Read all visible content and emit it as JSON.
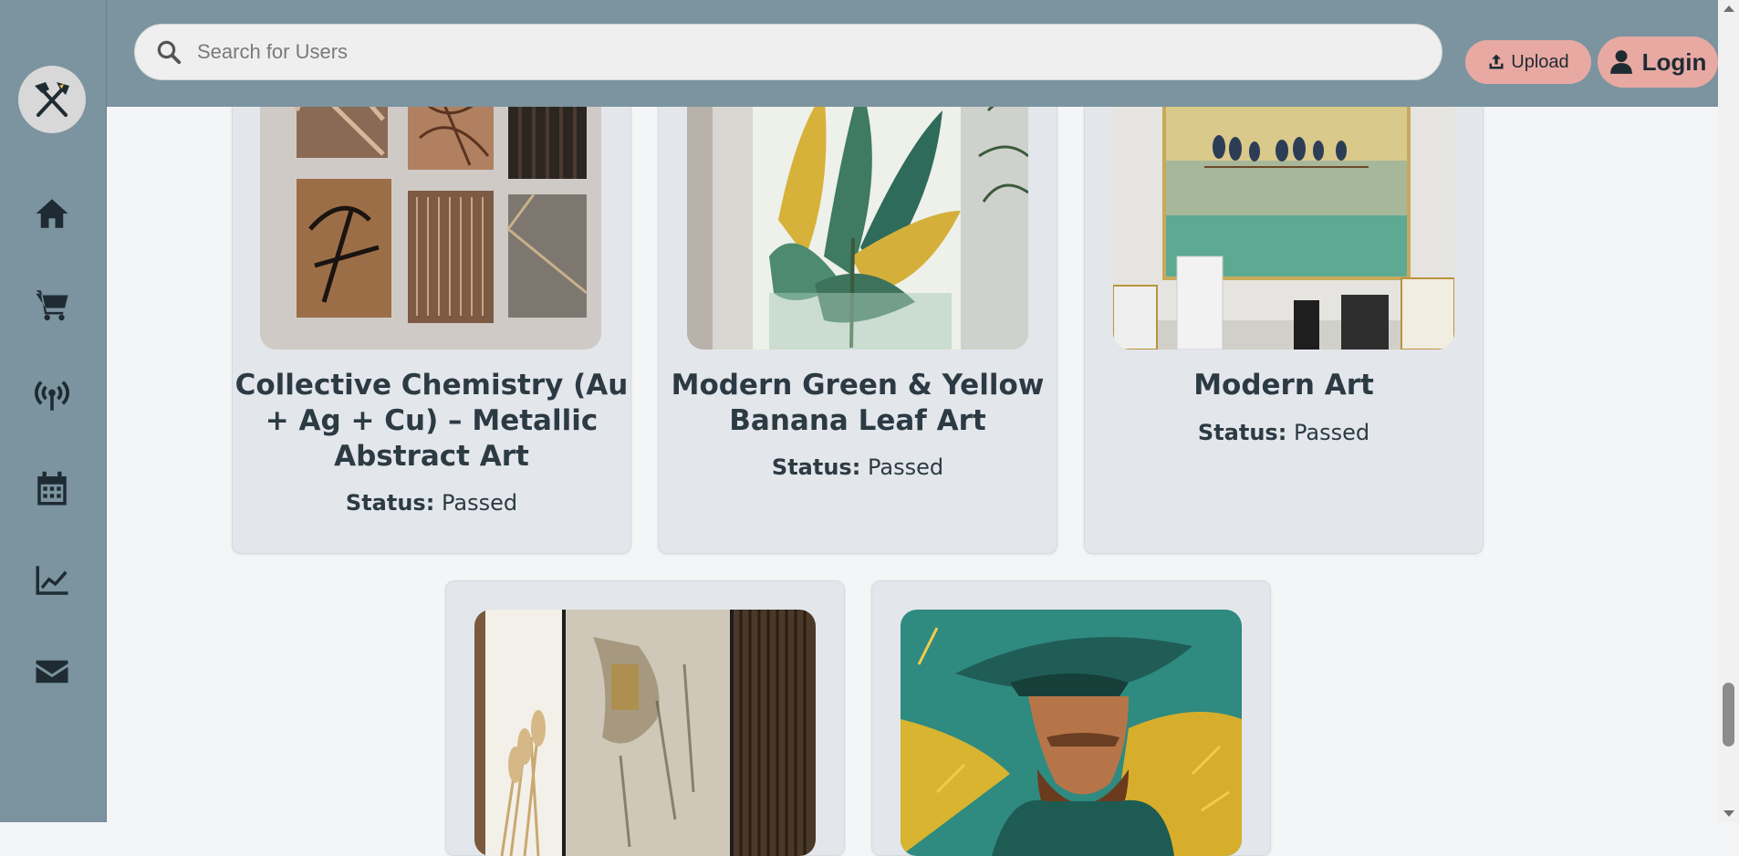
{
  "header": {
    "search_placeholder": "Search for Users",
    "upload_label": "Upload",
    "login_label": "Login"
  },
  "sidebar": {
    "items": [
      {
        "icon": "home-icon"
      },
      {
        "icon": "cart-icon"
      },
      {
        "icon": "broadcast-icon"
      },
      {
        "icon": "calendar-icon"
      },
      {
        "icon": "chart-line-icon"
      },
      {
        "icon": "envelope-icon"
      }
    ]
  },
  "cards": [
    {
      "title": "Collective Chemistry (Au + Ag + Cu) – Metallic Abstract Art",
      "status_label": "Status:",
      "status_value": "Passed"
    },
    {
      "title": "Modern Green & Yellow Banana Leaf Art",
      "status_label": "Status:",
      "status_value": "Passed"
    },
    {
      "title": "Modern Art",
      "status_label": "Status:",
      "status_value": "Passed"
    },
    {
      "title": "",
      "status_label": "",
      "status_value": ""
    },
    {
      "title": "",
      "status_label": "",
      "status_value": ""
    }
  ],
  "colors": {
    "sidebar": "#7b949f",
    "accent_button": "#e8a9a3",
    "card_bg": "#e3e6ea",
    "text_dark": "#2c3a44"
  }
}
